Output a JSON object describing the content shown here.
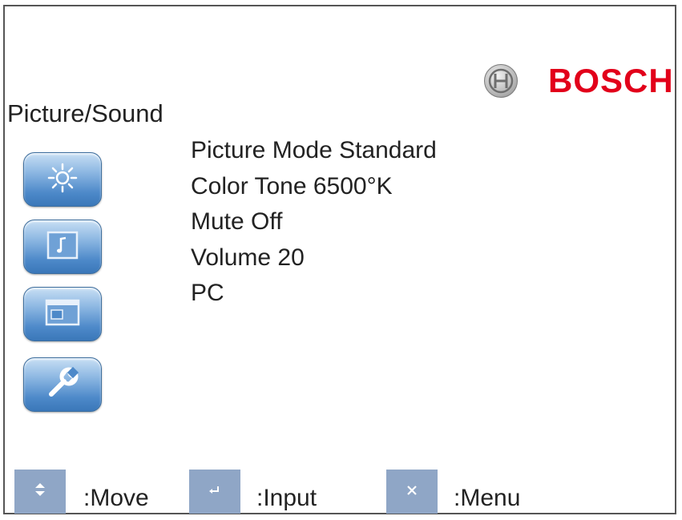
{
  "brand": {
    "name": "BOSCH"
  },
  "page": {
    "title": "Picture/Sound"
  },
  "sidebar": {
    "icons": [
      {
        "name": "picture-icon"
      },
      {
        "name": "sound-icon"
      },
      {
        "name": "display-icon"
      },
      {
        "name": "settings-icon"
      }
    ]
  },
  "menu": {
    "items": [
      {
        "label": "Picture Mode Standard"
      },
      {
        "label": "Color Tone 6500°K"
      },
      {
        "label": "Mute Off"
      },
      {
        "label": "Volume 20"
      },
      {
        "label": "PC"
      }
    ]
  },
  "footer": {
    "keys": [
      {
        "icon": "up-down-arrows-icon",
        "label": ":Move"
      },
      {
        "icon": "enter-icon",
        "label": ":Input"
      },
      {
        "icon": "close-icon",
        "label": ":Menu"
      }
    ]
  },
  "colors": {
    "brand_red": "#e2001a",
    "icon_blue": "#4d89c9",
    "key_blue": "#8fa6c6"
  }
}
